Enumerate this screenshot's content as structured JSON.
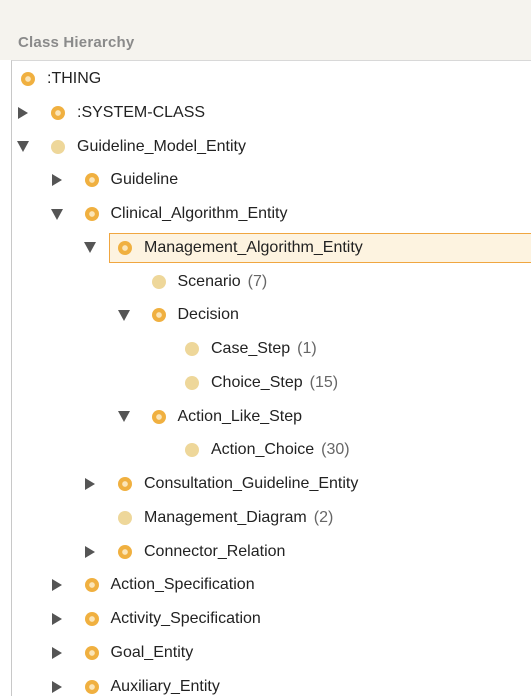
{
  "header": {
    "title": "Class Hierarchy"
  },
  "tree": [
    {
      "label": ":THING",
      "count": "",
      "toggle": "none",
      "icon": "abstract-class-icon",
      "depth": 0
    },
    {
      "label": ":SYSTEM-CLASS",
      "count": "",
      "toggle": "collapsed",
      "icon": "abstract-class-icon",
      "depth": 1
    },
    {
      "label": "Guideline_Model_Entity",
      "count": "",
      "toggle": "expanded",
      "icon": "concrete-class-icon",
      "depth": 1
    },
    {
      "label": "Guideline",
      "count": "",
      "toggle": "collapsed",
      "icon": "abstract-class-icon",
      "depth": 2
    },
    {
      "label": "Clinical_Algorithm_Entity",
      "count": "",
      "toggle": "expanded",
      "icon": "abstract-class-icon",
      "depth": 2
    },
    {
      "label": "Management_Algorithm_Entity",
      "count": "",
      "toggle": "expanded",
      "icon": "abstract-class-icon",
      "depth": 3,
      "selected": true
    },
    {
      "label": "Scenario",
      "count": "(7)",
      "toggle": "none",
      "icon": "concrete-class-icon",
      "depth": 4
    },
    {
      "label": "Decision",
      "count": "",
      "toggle": "expanded",
      "icon": "abstract-class-icon",
      "depth": 4
    },
    {
      "label": "Case_Step",
      "count": "(1)",
      "toggle": "none",
      "icon": "concrete-class-icon",
      "depth": 5
    },
    {
      "label": "Choice_Step",
      "count": "(15)",
      "toggle": "none",
      "icon": "concrete-class-icon",
      "depth": 5
    },
    {
      "label": "Action_Like_Step",
      "count": "",
      "toggle": "expanded",
      "icon": "abstract-class-icon",
      "depth": 4
    },
    {
      "label": "Action_Choice",
      "count": "(30)",
      "toggle": "none",
      "icon": "concrete-class-icon",
      "depth": 5
    },
    {
      "label": "Consultation_Guideline_Entity",
      "count": "",
      "toggle": "collapsed",
      "icon": "abstract-class-icon",
      "depth": 3
    },
    {
      "label": "Management_Diagram",
      "count": "(2)",
      "toggle": "none",
      "icon": "concrete-class-icon",
      "depth": 3
    },
    {
      "label": "Connector_Relation",
      "count": "",
      "toggle": "collapsed",
      "icon": "abstract-class-icon",
      "depth": 3
    },
    {
      "label": "Action_Specification",
      "count": "",
      "toggle": "collapsed",
      "icon": "abstract-class-icon",
      "depth": 2
    },
    {
      "label": "Activity_Specification",
      "count": "",
      "toggle": "collapsed",
      "icon": "abstract-class-icon",
      "depth": 2
    },
    {
      "label": "Goal_Entity",
      "count": "",
      "toggle": "collapsed",
      "icon": "abstract-class-icon",
      "depth": 2
    },
    {
      "label": "Auxiliary_Entity",
      "count": "",
      "toggle": "collapsed",
      "icon": "abstract-class-icon",
      "depth": 2
    }
  ]
}
